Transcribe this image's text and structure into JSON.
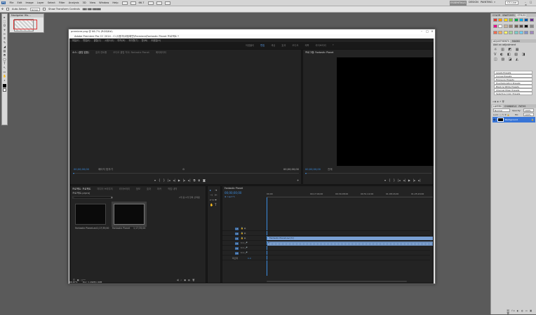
{
  "photoshop": {
    "menu": [
      "PS",
      "File",
      "Edit",
      "Image",
      "Layer",
      "Select",
      "Filter",
      "Analysis",
      "3D",
      "View",
      "Window",
      "Help"
    ],
    "zoom": "66.7",
    "workspaces": {
      "essentials": "ESSENTIALS",
      "design": "DESIGN",
      "painting": "PAINTING",
      "more": "»",
      "search": "CS Live"
    },
    "options": {
      "tool_label": "Auto-Select:",
      "group": "Group",
      "show_transform": "Show Transform Controls"
    },
    "navigator_tabs": "Navigator  His...",
    "tools": [
      "▸",
      "⬚",
      "ʘ",
      "⌖",
      "✂",
      "⌗",
      "✎",
      "◢",
      "▨",
      "◓",
      "◯",
      "T",
      "↖",
      "▭",
      "✋",
      "⌕"
    ],
    "right_panel": {
      "top_tabs": [
        "COLOR",
        "SWATCHES",
        "STYLES"
      ],
      "adj_tabs": [
        "ADJUSTMENTS",
        "MASKS"
      ],
      "add_adjustment": "Add an adjustment",
      "presets": [
        "Levels Presets",
        "Curves Presets",
        "Exposure Presets",
        "Hue/Saturation Presets",
        "Black & White Presets",
        "Channel Mixer Presets",
        "Selective Color Presets"
      ],
      "layer_tabs": [
        "LAYERS",
        "CHANNELS",
        "PATHS"
      ],
      "blend": "Normal",
      "opacity_label": "Opacity:",
      "opacity": "100%",
      "lock_label": "Lock:",
      "fill_label": "Fill:",
      "fill": "100%",
      "layer_name": "Background",
      "swatch_colors": [
        "#e23b2e",
        "#ff9a00",
        "#ffd500",
        "#8dc63f",
        "#00a650",
        "#00aeef",
        "#0054a6",
        "#662d91",
        "#ec008c",
        "#ffffff",
        "#c7b299",
        "#998675",
        "#736357",
        "#534741",
        "#000000",
        "#888888",
        "#f26c4f",
        "#fbaf5d",
        "#fff568",
        "#a3d39c",
        "#7accc8",
        "#6dcff6",
        "#8393ca",
        "#a187be"
      ]
    },
    "status": {
      "zoom": "66.67%",
      "doc": "Doc: 1.49M/1.49M"
    }
  },
  "premiere": {
    "doc_title": "premiere.png @ 66.7% (RGB/8#)",
    "window_title": "Adobe Premiere Pro CC 2014 - C:\\사용자\\바탕화면\\Premiere\\Fantastic Planet 프로젝트 *",
    "menu": [
      "파일(F)",
      "편집(E)",
      "클립(C)",
      "시퀀스(S)",
      "마커(M)",
      "타이틀(T)",
      "창(W)",
      "도움말(H)"
    ],
    "workspace_tabs": [
      "어셈블리",
      "편집",
      "색상",
      "효과",
      "오디오",
      "제목",
      "라이브러리",
      "»"
    ],
    "source": {
      "tabs": [
        "소스: (클립 없음)",
        "효과 컨트롤",
        "오디오 클립 믹서: Fantastic Planet",
        "메타데이터"
      ],
      "tc_in": "00;00;00;00",
      "fit": "페이지 맞추기",
      "tc_out": "00;00;00;00"
    },
    "program": {
      "tabs": [
        "프로그램: Fantastic Planet"
      ],
      "tc_in": "00;00;00;00",
      "fit": "전체",
      "tc_out": "00;00;00;00"
    },
    "project": {
      "tabs": [
        "프로젝트: 프로젝트",
        "미디어 브라우저",
        "라이브러리",
        "정보",
        "효과",
        "마커",
        "작업 내역"
      ],
      "name": "프로젝트.prproj",
      "count": "2개 중 0개 항목 선택됨",
      "items": [
        {
          "name": "Fantastic Planet.avi",
          "duration": "1;17;35;00"
        },
        {
          "name": "Fantastic Planet",
          "duration": "1;17;35;00"
        }
      ]
    },
    "timeline": {
      "tab": "Fantastic Planet",
      "tc": "00;00;00;00",
      "ruler": [
        "00;00",
        "00;17;04;00",
        "00;34;08;00",
        "00;51;12;00",
        "01;08;16;00",
        "01;25;20;00"
      ],
      "tracks": [
        "V3",
        "V2",
        "V1",
        "A1",
        "A2",
        "A3"
      ],
      "master": "마스터",
      "master_value": "0.0",
      "video_clip": "Fantastic Planet.avi [V]",
      "audio_clip": "fx"
    }
  }
}
